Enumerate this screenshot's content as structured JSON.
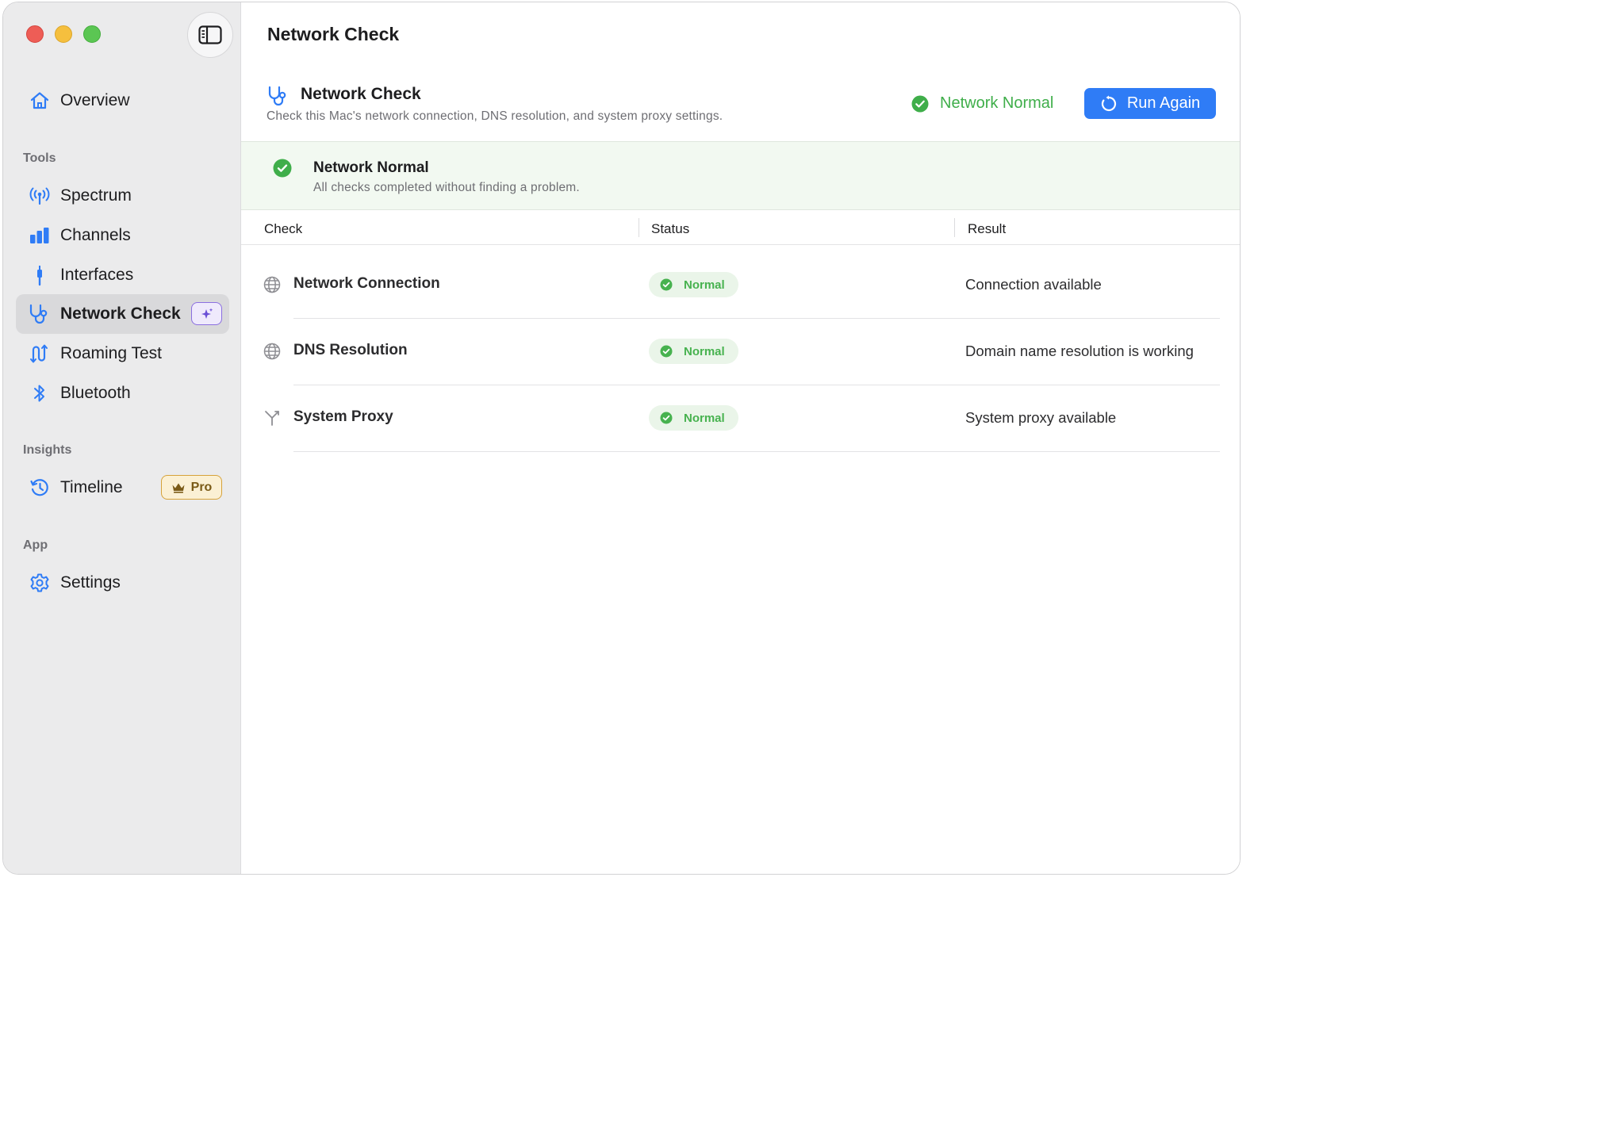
{
  "window": {
    "title": "Network Check"
  },
  "sidebar": {
    "overview": {
      "label": "Overview",
      "icon": "house-icon"
    },
    "sections": [
      {
        "label": "Tools"
      },
      {
        "label": "Insights"
      },
      {
        "label": "App"
      }
    ],
    "tools": [
      {
        "label": "Spectrum",
        "icon": "antenna-icon"
      },
      {
        "label": "Channels",
        "icon": "bar-chart-icon"
      },
      {
        "label": "Interfaces",
        "icon": "cable-icon"
      },
      {
        "label": "Network Check",
        "icon": "stethoscope-icon",
        "active": true,
        "badge_icon": "sparkle-icon"
      },
      {
        "label": "Roaming Test",
        "icon": "roaming-icon"
      },
      {
        "label": "Bluetooth",
        "icon": "bluetooth-icon"
      }
    ],
    "insights": [
      {
        "label": "Timeline",
        "icon": "clock-history-icon",
        "badge": "Pro"
      }
    ],
    "app": [
      {
        "label": "Settings",
        "icon": "gear-icon"
      }
    ]
  },
  "header": {
    "title": "Network Check",
    "subtitle": "Check this Mac's network connection, DNS resolution, and system proxy settings.",
    "status": "Network Normal",
    "run_button": "Run Again"
  },
  "banner": {
    "title": "Network Normal",
    "subtitle": "All checks completed without finding a problem."
  },
  "table": {
    "columns": [
      "Check",
      "Status",
      "Result"
    ],
    "rows": [
      {
        "check": "Network Connection",
        "icon": "globe-icon",
        "status": "Normal",
        "result": "Connection available"
      },
      {
        "check": "DNS Resolution",
        "icon": "globe-icon",
        "status": "Normal",
        "result": "Domain name resolution is working"
      },
      {
        "check": "System Proxy",
        "icon": "proxy-fork-icon",
        "status": "Normal",
        "result": "System proxy available"
      }
    ]
  },
  "colors": {
    "accent": "#2f7cf6",
    "success": "#3fae4a",
    "sidebar_bg": "#ebebec",
    "pro_gold": "#d6a23a"
  }
}
